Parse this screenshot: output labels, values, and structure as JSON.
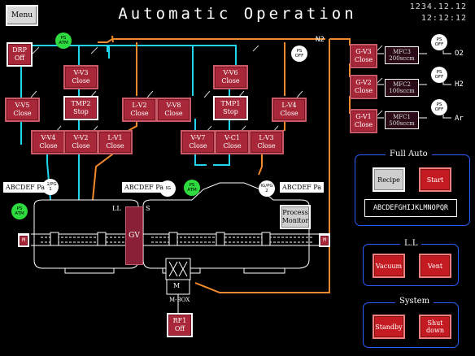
{
  "header": {
    "title": "Automatic Operation",
    "menu_label": "Menu",
    "date": "1234.12.12",
    "time": "12:12:12"
  },
  "valves": {
    "drp": [
      "DRP",
      "Off"
    ],
    "v_v3": [
      "V-V3",
      "Close"
    ],
    "v_v5": [
      "V-V5",
      "Close"
    ],
    "tmp2": [
      "TMP2",
      "Stop"
    ],
    "l_v2": [
      "L-V2",
      "Close"
    ],
    "v_v8": [
      "V-V8",
      "Close"
    ],
    "v_v6": [
      "V-V6",
      "Close"
    ],
    "tmp1": [
      "TMP1",
      "Stop"
    ],
    "l_v4": [
      "L-V4",
      "Close"
    ],
    "v_v4": [
      "V-V4",
      "Close"
    ],
    "v_v2": [
      "V-V2",
      "Close"
    ],
    "l_v1": [
      "L-V1",
      "Close"
    ],
    "v_v7": [
      "V-V7",
      "Close"
    ],
    "v_c1": [
      "V-C1",
      "Close"
    ],
    "l_v3": [
      "L-V3",
      "Close"
    ],
    "g_v3": [
      "G-V3",
      "Close"
    ],
    "g_v2": [
      "G-V2",
      "Close"
    ],
    "g_v1": [
      "G-V1",
      "Close"
    ],
    "rf1": [
      "RF1",
      "Off"
    ]
  },
  "mfc": {
    "mfc3": [
      "MFC3",
      "200sccm"
    ],
    "mfc2": [
      "MFC2",
      "100sccm"
    ],
    "mfc1": [
      "MFC1",
      "500sccm"
    ]
  },
  "gases": {
    "n2": "N2",
    "o2": "O2",
    "h2": "H2",
    "ar": "Ar"
  },
  "gauges": {
    "ps_atm_top": [
      "PS",
      "ATM"
    ],
    "ps_off_n2": [
      "PS",
      "OFF"
    ],
    "ps_off_o2": [
      "PS",
      "OFF"
    ],
    "ps_off_h2": [
      "PS",
      "OFF"
    ],
    "ps_off_ar": [
      "PS",
      "OFF"
    ],
    "ig_pg1": [
      "IG/PG",
      "1"
    ],
    "bg": [
      "BG",
      ""
    ],
    "ps_atm_mid": [
      "PS",
      "ATM"
    ],
    "ig_pg2": [
      "IG/PG",
      "2"
    ],
    "ps_atm_ll": [
      "PS",
      "ATM"
    ]
  },
  "pressures": {
    "ll": "ABCDEF Pa",
    "s_left": "ABCDEF Pa",
    "s_right": "ABCDEF Pa"
  },
  "chambers": {
    "ll_label": "LL",
    "s_label": "S",
    "gv_label": "GV",
    "mbox_label": "M-BOX",
    "m_left": "M",
    "m_right": "M",
    "m_box_mark": "M"
  },
  "process_monitor": [
    "Process",
    "Monitor"
  ],
  "panels": {
    "full_auto": {
      "title": "Full Auto",
      "recipe": "Recipe",
      "start": "Start",
      "recipe_name": "ABCDEFGHIJKLMNOPQR"
    },
    "ll": {
      "title": "L.L",
      "vacuum": "Vacuum",
      "vent": "Vent"
    },
    "system": {
      "title": "System",
      "standby": "Standby",
      "shutdown": [
        "Shut",
        "down"
      ]
    }
  },
  "colors": {
    "cyan_line": "#22d3ee",
    "orange_line": "#f08a2c",
    "valve": "#a8283a",
    "panel_border": "#2a5cff",
    "gauge_green": "#2fdc3f"
  }
}
